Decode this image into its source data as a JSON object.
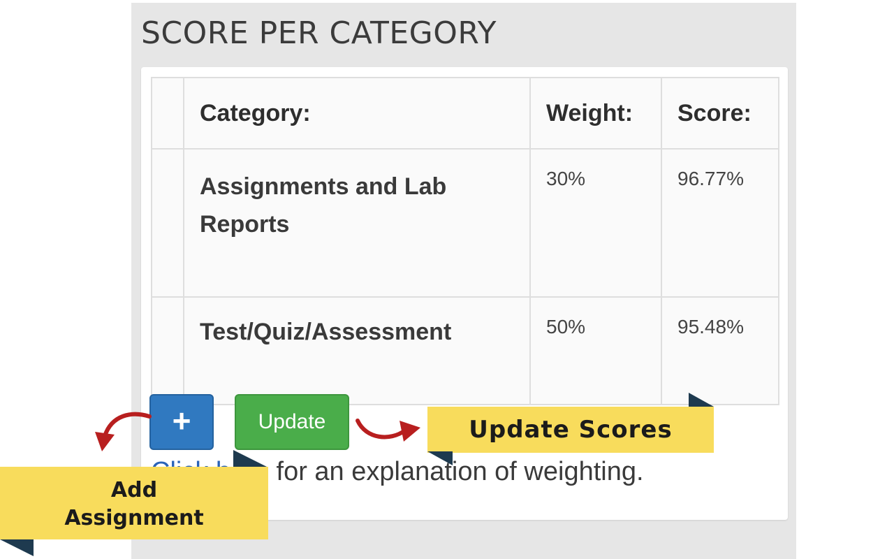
{
  "panel": {
    "title": "SCORE PER CATEGORY"
  },
  "table": {
    "headers": {
      "category": "Category:",
      "weight": "Weight:",
      "score": "Score:"
    },
    "rows": [
      {
        "category": "Assignments and Lab Reports",
        "weight": "30%",
        "score": "96.77%"
      },
      {
        "category": "Test/Quiz/Assessment",
        "weight": "50%",
        "score": "95.48%"
      }
    ]
  },
  "buttons": {
    "add_label": "+",
    "update_label": "Update"
  },
  "explanation": {
    "link_text": "Click here",
    "rest_text": " for an explanation of weighting."
  },
  "callouts": {
    "update_scores": "Update Scores",
    "add_assignment_line1": "Add",
    "add_assignment_line2": "Assignment"
  },
  "colors": {
    "panel_bg": "#e6e6e6",
    "add_button": "#3079c0",
    "update_button": "#4aad4a",
    "callout": "#f8dc5c",
    "arrow": "#b81f1f",
    "link": "#2a63b8"
  },
  "icons": {
    "arrow_left": "curved-arrow-left-icon",
    "arrow_right": "curved-arrow-right-icon"
  }
}
